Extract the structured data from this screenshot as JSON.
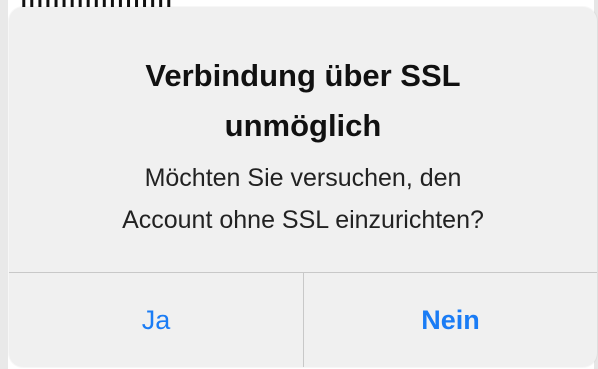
{
  "background": {
    "cut_text": "lllllllllllllllllll"
  },
  "alert": {
    "title_line1": "Verbindung über SSL",
    "title_line2": "unmöglich",
    "message_line1": "Möchten Sie versuchen, den",
    "message_line2": "Account ohne SSL einzurichten?",
    "buttons": {
      "yes_label": "Ja",
      "no_label": "Nein"
    }
  },
  "colors": {
    "alert_background": "#f0f0f0",
    "button_text": "#1a7cf5",
    "divider": "#c8c8c8"
  }
}
